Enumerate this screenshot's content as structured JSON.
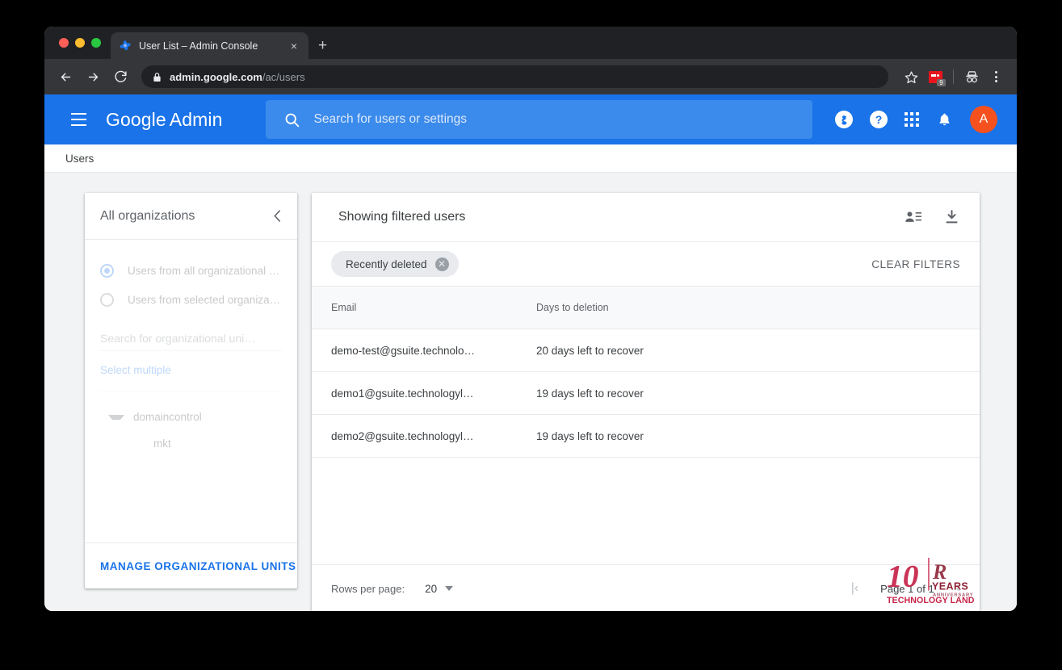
{
  "browser": {
    "tab": {
      "title": "User List – Admin Console",
      "favicon": "admin-console-favicon",
      "close": "×"
    },
    "new_tab": "+",
    "nav": {
      "back": "←",
      "forward": "→",
      "reload": "⟳"
    },
    "omnibox": {
      "lock_icon": "lock-icon",
      "url_scheme": "https://",
      "url_host": "admin.google.com",
      "url_path": "/ac/users"
    },
    "actions": {
      "bookmark": "☆",
      "extension_badge": "9",
      "incognito": "incognito-icon",
      "menu": "kebab-menu"
    }
  },
  "admin_header": {
    "menu_icon": "hamburger-icon",
    "brand_google": "Google",
    "brand_admin": "Admin",
    "search": {
      "icon": "search-icon",
      "placeholder": "Search for users or settings",
      "value": ""
    },
    "support_icon": "g-support-icon",
    "help_icon": "?",
    "apps_icon": "apps-grid-icon",
    "notifications_icon": "bell-icon",
    "avatar_letter": "A"
  },
  "breadcrumb": {
    "current": "Users"
  },
  "org_panel": {
    "title": "All organizations",
    "collapse_icon": "chevron-left-icon",
    "radios": [
      {
        "label": "Users from all organizational uni…",
        "selected": true
      },
      {
        "label": "Users from selected organizatio…",
        "selected": false
      }
    ],
    "search_placeholder": "Search for organizational uni…",
    "select_multiple": "Select multiple",
    "tree": {
      "root": "domaincontrol",
      "child": "mkt"
    },
    "footer_button": "MANAGE ORGANIZATIONAL UNITS"
  },
  "users_panel": {
    "title": "Showing filtered users",
    "actions": [
      {
        "name": "user-list-icon"
      },
      {
        "name": "download-icon"
      }
    ],
    "filter_chip": {
      "label": "Recently deleted",
      "remove_icon": "✕"
    },
    "clear_filters": "CLEAR FILTERS",
    "table": {
      "columns": [
        "Email",
        "Days to deletion"
      ],
      "rows": [
        {
          "email": "demo-test@gsuite.technolo…",
          "days": "20 days left to recover"
        },
        {
          "email": "demo1@gsuite.technologyl…",
          "days": "19 days left to recover"
        },
        {
          "email": "demo2@gsuite.technologyl…",
          "days": "19 days left to recover"
        }
      ]
    },
    "pagination": {
      "rows_per_page_label": "Rows per page:",
      "rows_per_page_value": "20",
      "first_page_icon": "|‹",
      "page_text": "Page 1 of 1",
      "prev_page_icon": "‹"
    }
  },
  "watermark": {
    "number": "10",
    "r": "R",
    "years": "YEARS",
    "anniversary": "ANNIVERSARY",
    "company": "TECHNOLOGY LAND"
  },
  "colors": {
    "admin_blue": "#1a73e8",
    "avatar_orange": "#f4511e",
    "link_blue": "#1a73e8",
    "watermark_red": "#c62348",
    "browser_dark": "#35363a"
  }
}
